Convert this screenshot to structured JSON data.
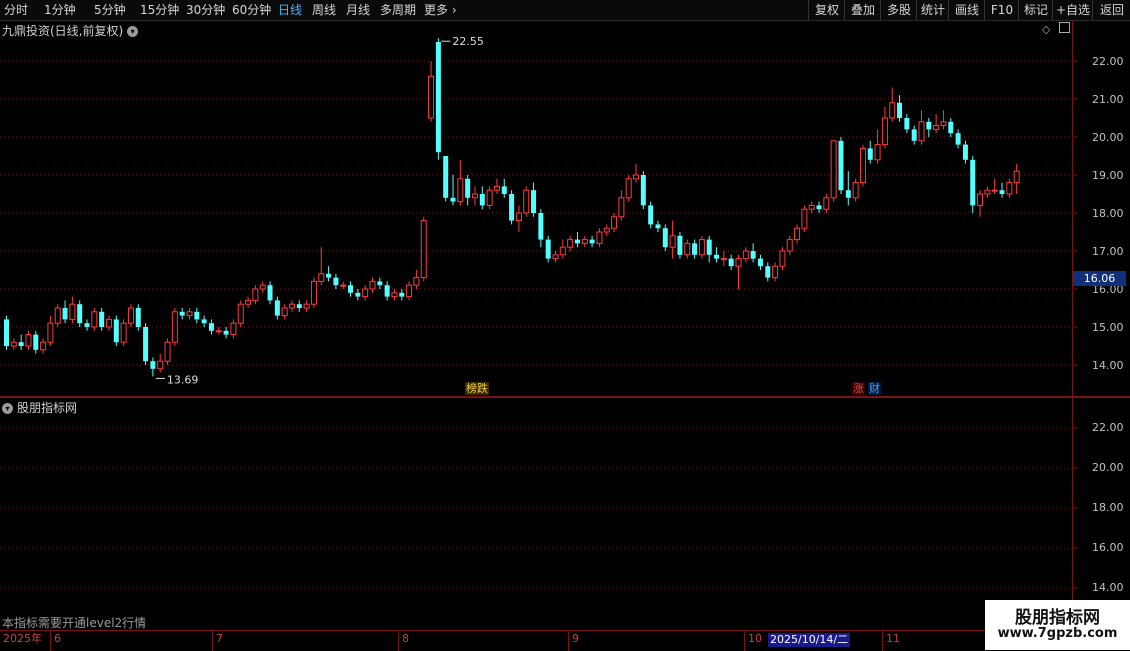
{
  "toolbar": {
    "left_items": [
      "分时",
      "1分钟",
      "5分钟",
      "15分钟",
      "30分钟",
      "60分钟",
      "日线",
      "周线",
      "月线",
      "多周期",
      "更多"
    ],
    "active_item": "日线",
    "right_items": [
      "复权",
      "叠加",
      "多股",
      "统计",
      "画线",
      "F10",
      "标记",
      "+自选",
      "返回"
    ]
  },
  "main_panel": {
    "title": "九鼎投资(日线,前复权)",
    "price_labels": [
      "22.00",
      "21.00",
      "20.00",
      "19.00",
      "18.00",
      "17.00",
      "16.00",
      "15.00",
      "14.00"
    ],
    "current_price": "16.06",
    "high_marker": "22.55",
    "low_marker": "13.69",
    "badges": [
      {
        "text": "榜跌",
        "color": "#f0d040"
      },
      {
        "text": "涨",
        "color": "#ff4040"
      },
      {
        "text": "财",
        "color": "#40a0ff"
      }
    ]
  },
  "sub_panel": {
    "title": "股朋指标网",
    "price_labels": [
      "22.00",
      "20.00",
      "18.00",
      "16.00",
      "14.00"
    ],
    "notice": "本指标需要开通level2行情"
  },
  "date_bar": {
    "year": "2025年",
    "months": [
      "6",
      "7",
      "8",
      "9",
      "10",
      "11"
    ],
    "cursor_date": "2025/10/14/二"
  },
  "watermark": {
    "title": "股朋指标网",
    "url": "www.7gpzb.com"
  },
  "colors": {
    "up": "#ff3b3b",
    "down": "#54ffff",
    "grid": "#7a1414",
    "current_price_bg": "#12307a"
  },
  "chart_data": {
    "type": "candlestick",
    "price_range": [
      13.4,
      22.7
    ],
    "candles": [
      [
        15.2,
        14.5,
        15.3,
        14.4
      ],
      [
        14.5,
        14.6,
        14.7,
        14.4
      ],
      [
        14.6,
        14.5,
        14.8,
        14.4
      ],
      [
        14.5,
        14.8,
        14.9,
        14.4
      ],
      [
        14.8,
        14.4,
        14.9,
        14.3
      ],
      [
        14.4,
        14.6,
        14.7,
        14.3
      ],
      [
        14.6,
        15.1,
        15.3,
        14.5
      ],
      [
        15.1,
        15.5,
        15.6,
        15.0
      ],
      [
        15.5,
        15.2,
        15.7,
        15.1
      ],
      [
        15.2,
        15.6,
        15.8,
        15.1
      ],
      [
        15.6,
        15.1,
        15.7,
        15.0
      ],
      [
        15.1,
        15.0,
        15.2,
        14.9
      ],
      [
        15.0,
        15.4,
        15.5,
        14.9
      ],
      [
        15.4,
        15.0,
        15.5,
        14.9
      ],
      [
        15.0,
        15.2,
        15.3,
        14.9
      ],
      [
        15.2,
        14.6,
        15.3,
        14.5
      ],
      [
        14.6,
        15.1,
        15.2,
        14.5
      ],
      [
        15.1,
        15.5,
        15.6,
        15.0
      ],
      [
        15.5,
        15.0,
        15.6,
        14.9
      ],
      [
        15.0,
        14.1,
        15.1,
        14.0
      ],
      [
        14.1,
        13.9,
        14.2,
        13.7
      ],
      [
        13.9,
        14.1,
        14.3,
        13.8
      ],
      [
        14.1,
        14.6,
        14.7,
        14.0
      ],
      [
        14.6,
        15.4,
        15.5,
        14.5
      ],
      [
        15.4,
        15.3,
        15.5,
        15.2
      ],
      [
        15.3,
        15.4,
        15.5,
        15.2
      ],
      [
        15.4,
        15.2,
        15.5,
        15.1
      ],
      [
        15.2,
        15.1,
        15.3,
        15.0
      ],
      [
        15.1,
        14.9,
        15.2,
        14.8
      ],
      [
        14.9,
        14.9,
        15.0,
        14.8
      ],
      [
        14.9,
        14.8,
        15.0,
        14.7
      ],
      [
        14.8,
        15.1,
        15.2,
        14.7
      ],
      [
        15.1,
        15.6,
        15.7,
        15.0
      ],
      [
        15.6,
        15.7,
        15.8,
        15.5
      ],
      [
        15.7,
        16.0,
        16.1,
        15.6
      ],
      [
        16.0,
        16.1,
        16.2,
        15.9
      ],
      [
        16.1,
        15.7,
        16.2,
        15.6
      ],
      [
        15.7,
        15.3,
        15.8,
        15.2
      ],
      [
        15.3,
        15.5,
        15.6,
        15.2
      ],
      [
        15.5,
        15.6,
        15.7,
        15.4
      ],
      [
        15.6,
        15.5,
        15.7,
        15.4
      ],
      [
        15.5,
        15.6,
        15.7,
        15.4
      ],
      [
        15.6,
        16.2,
        16.3,
        15.5
      ],
      [
        16.2,
        16.4,
        17.1,
        16.1
      ],
      [
        16.4,
        16.3,
        16.6,
        16.2
      ],
      [
        16.3,
        16.1,
        16.4,
        16.0
      ],
      [
        16.1,
        16.1,
        16.2,
        16.0
      ],
      [
        16.1,
        15.9,
        16.2,
        15.8
      ],
      [
        15.9,
        15.8,
        16.0,
        15.7
      ],
      [
        15.8,
        16.0,
        16.1,
        15.7
      ],
      [
        16.0,
        16.2,
        16.3,
        15.9
      ],
      [
        16.2,
        16.1,
        16.3,
        16.0
      ],
      [
        16.1,
        15.8,
        16.2,
        15.7
      ],
      [
        15.8,
        15.9,
        16.0,
        15.7
      ],
      [
        15.9,
        15.8,
        16.0,
        15.7
      ],
      [
        15.8,
        16.1,
        16.2,
        15.7
      ],
      [
        16.1,
        16.3,
        16.5,
        16.0
      ],
      [
        16.3,
        17.8,
        17.9,
        16.2
      ],
      [
        20.5,
        21.6,
        22.0,
        20.4
      ],
      [
        22.5,
        19.6,
        22.6,
        19.4
      ],
      [
        19.5,
        18.4,
        19.5,
        18.3
      ],
      [
        18.4,
        18.3,
        19.0,
        18.2
      ],
      [
        18.3,
        18.9,
        19.4,
        18.2
      ],
      [
        18.9,
        18.4,
        19.0,
        18.2
      ],
      [
        18.4,
        18.5,
        18.7,
        18.2
      ],
      [
        18.5,
        18.2,
        18.7,
        18.1
      ],
      [
        18.2,
        18.6,
        18.7,
        18.1
      ],
      [
        18.6,
        18.7,
        18.9,
        18.5
      ],
      [
        18.7,
        18.5,
        18.9,
        18.4
      ],
      [
        18.5,
        17.8,
        18.6,
        17.7
      ],
      [
        17.8,
        18.0,
        18.2,
        17.5
      ],
      [
        18.0,
        18.6,
        18.7,
        17.9
      ],
      [
        18.6,
        18.0,
        18.8,
        17.9
      ],
      [
        18.0,
        17.3,
        18.1,
        17.1
      ],
      [
        17.3,
        16.8,
        17.4,
        16.7
      ],
      [
        16.8,
        16.9,
        17.0,
        16.7
      ],
      [
        16.9,
        17.1,
        17.3,
        16.8
      ],
      [
        17.1,
        17.3,
        17.4,
        17.0
      ],
      [
        17.3,
        17.2,
        17.5,
        17.1
      ],
      [
        17.2,
        17.3,
        17.4,
        17.1
      ],
      [
        17.3,
        17.2,
        17.4,
        17.1
      ],
      [
        17.2,
        17.5,
        17.6,
        17.1
      ],
      [
        17.5,
        17.6,
        17.7,
        17.4
      ],
      [
        17.6,
        17.9,
        18.0,
        17.5
      ],
      [
        17.9,
        18.4,
        18.6,
        17.8
      ],
      [
        18.4,
        18.9,
        19.0,
        18.3
      ],
      [
        18.9,
        19.0,
        19.3,
        18.8
      ],
      [
        19.0,
        18.2,
        19.1,
        18.1
      ],
      [
        18.2,
        17.7,
        18.3,
        17.6
      ],
      [
        17.7,
        17.6,
        17.8,
        17.5
      ],
      [
        17.6,
        17.1,
        17.7,
        17.0
      ],
      [
        17.1,
        17.4,
        17.8,
        16.8
      ],
      [
        17.4,
        16.9,
        17.5,
        16.8
      ],
      [
        16.9,
        17.2,
        17.3,
        16.8
      ],
      [
        17.2,
        16.9,
        17.3,
        16.8
      ],
      [
        16.9,
        17.3,
        17.4,
        16.8
      ],
      [
        17.3,
        16.9,
        17.4,
        16.7
      ],
      [
        16.9,
        16.8,
        17.1,
        16.7
      ],
      [
        16.8,
        16.8,
        17.0,
        16.6
      ],
      [
        16.8,
        16.6,
        16.9,
        16.5
      ],
      [
        16.6,
        16.8,
        16.9,
        16.0
      ],
      [
        16.8,
        17.0,
        17.1,
        16.7
      ],
      [
        17.0,
        16.8,
        17.2,
        16.7
      ],
      [
        16.8,
        16.6,
        16.9,
        16.5
      ],
      [
        16.6,
        16.3,
        16.7,
        16.2
      ],
      [
        16.3,
        16.6,
        16.7,
        16.2
      ],
      [
        16.6,
        17.0,
        17.1,
        16.5
      ],
      [
        17.0,
        17.3,
        17.4,
        16.9
      ],
      [
        17.3,
        17.6,
        17.7,
        17.2
      ],
      [
        17.6,
        18.1,
        18.2,
        17.5
      ],
      [
        18.1,
        18.2,
        18.3,
        18.0
      ],
      [
        18.2,
        18.1,
        18.3,
        18.0
      ],
      [
        18.1,
        18.4,
        18.5,
        18.0
      ],
      [
        18.4,
        19.9,
        19.9,
        18.3
      ],
      [
        19.9,
        18.6,
        20.0,
        18.5
      ],
      [
        18.6,
        18.4,
        19.1,
        18.2
      ],
      [
        18.4,
        18.8,
        18.9,
        18.3
      ],
      [
        18.8,
        19.7,
        19.8,
        18.7
      ],
      [
        19.7,
        19.4,
        19.9,
        19.3
      ],
      [
        19.4,
        19.8,
        20.2,
        19.3
      ],
      [
        19.8,
        20.5,
        20.8,
        19.7
      ],
      [
        20.5,
        20.9,
        21.3,
        20.4
      ],
      [
        20.9,
        20.5,
        21.1,
        20.4
      ],
      [
        20.5,
        20.2,
        20.6,
        20.1
      ],
      [
        20.2,
        19.9,
        20.3,
        19.8
      ],
      [
        19.9,
        20.4,
        20.7,
        19.8
      ],
      [
        20.4,
        20.2,
        20.5,
        20.0
      ],
      [
        20.2,
        20.3,
        20.6,
        20.1
      ],
      [
        20.3,
        20.4,
        20.7,
        20.2
      ],
      [
        20.4,
        20.1,
        20.5,
        20.0
      ],
      [
        20.1,
        19.8,
        20.2,
        19.7
      ],
      [
        19.8,
        19.4,
        19.9,
        19.3
      ],
      [
        19.4,
        18.2,
        19.5,
        18.0
      ],
      [
        18.2,
        18.5,
        18.6,
        17.9
      ],
      [
        18.5,
        18.6,
        18.7,
        18.4
      ],
      [
        18.6,
        18.6,
        18.9,
        18.5
      ],
      [
        18.6,
        18.5,
        18.8,
        18.4
      ],
      [
        18.5,
        18.8,
        18.9,
        18.4
      ],
      [
        18.8,
        19.1,
        19.3,
        18.5
      ]
    ]
  }
}
